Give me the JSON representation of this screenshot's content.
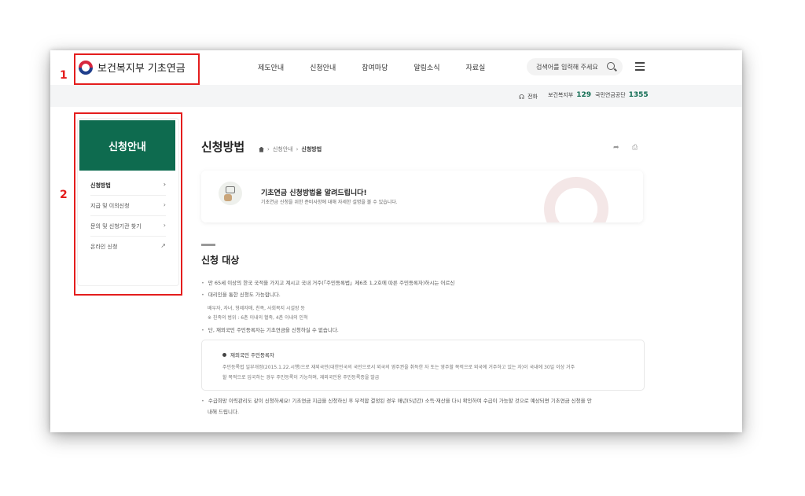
{
  "header": {
    "logo_text": "보건복지부 기초연금",
    "nav": [
      "제도안내",
      "신청안내",
      "참여마당",
      "알림소식",
      "자료실"
    ],
    "search_placeholder": "검색어를 입력해 주세요"
  },
  "subbar": {
    "phone_label": "전화",
    "contacts": [
      {
        "label": "보건복지부",
        "number": "129"
      },
      {
        "label": "국민연금공단",
        "number": "1355"
      }
    ]
  },
  "sidebar": {
    "title": "신청안내",
    "items": [
      {
        "label": "신청방법",
        "icon": "chevron-right-icon"
      },
      {
        "label": "지급 및 이의신청",
        "icon": "chevron-right-icon"
      },
      {
        "label": "문의 및 신청기관 찾기",
        "icon": "chevron-right-icon"
      },
      {
        "label": "온라인 신청",
        "icon": "external-link-icon"
      }
    ]
  },
  "page": {
    "title": "신청방법",
    "breadcrumb": [
      "신청안내",
      "신청방법"
    ]
  },
  "banner": {
    "title": "기초연금 신청방법을 알려드립니다!",
    "desc": "기초연금 신청을 위한 준비사항에 대해 자세한 설명을 볼 수 있습니다."
  },
  "section": {
    "title": "신청 대상",
    "line1": "만 65세 이상의 한국 국적을 가지고 계시고 국내 거주(「주민등록법」제6조 1,2호에 따른 주민등록자)하시는 어르신",
    "line2": "대리인을 통한 신청도 가능합니다.",
    "sub1": "배우자, 자녀, 형제자매, 친족, 사회복지 시설장 등",
    "sub2": "※ 친족의 범위 : 6촌 이내의 혈족, 4촌 이내의 인척",
    "line3": "단, 재외국민 주민등록자는 기초연금을 신청하실 수 없습니다.",
    "note_title": "재외국민 주민등록자",
    "note_line1": "주민등록법 일부개정(2015.1.22.시행)으로 재외국민(대한민국의 국민으로서 외국의 영주권을 취득한 자 또는 영주할 목적으로 외국에 거주하고 있는 자)이 국내에 30일 이상 거주",
    "note_line2": "할 목적으로 입국하는 경우 주민등록이 가능하며, 재외국민용 주민등록증을 발급",
    "line4": "수급희망 이력관리도 같이 신청하세요! 기초연금 지급을 신청하신 후 부적합 결정된 경우 매년(5년간) 소득·재산을 다시 확인하여 수급이 가능할 것으로 예상되면 기초연금 신청을 안",
    "line5": "내해 드립니다."
  },
  "annotations": {
    "n1": "1",
    "n2": "2",
    "color": "#e41d1d"
  },
  "colors": {
    "brand": "#0e6b4f"
  }
}
